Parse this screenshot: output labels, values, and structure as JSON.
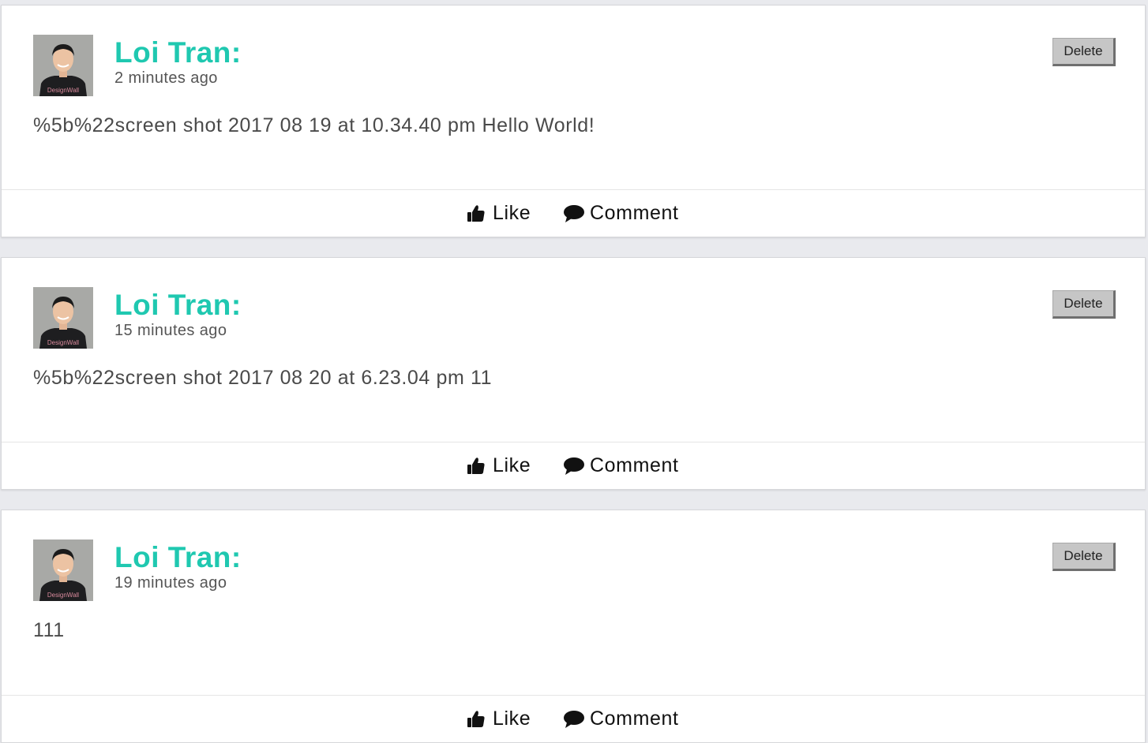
{
  "posts": [
    {
      "author": "Loi Tran:",
      "time_ago": "2 minutes ago",
      "body": "%5b%22screen shot 2017 08 19 at 10.34.40 pm Hello World!",
      "delete_label": "Delete",
      "like_label": "Like",
      "comment_label": "Comment",
      "avatar_shirt_text": "DesignWall"
    },
    {
      "author": "Loi Tran:",
      "time_ago": "15 minutes ago",
      "body": "%5b%22screen shot 2017 08 20 at 6.23.04 pm 11",
      "delete_label": "Delete",
      "like_label": "Like",
      "comment_label": "Comment",
      "avatar_shirt_text": "DesignWall"
    },
    {
      "author": "Loi Tran:",
      "time_ago": "19 minutes ago",
      "body": "111",
      "delete_label": "Delete",
      "like_label": "Like",
      "comment_label": "Comment",
      "avatar_shirt_text": "DesignWall"
    }
  ],
  "icons": {
    "avatar": "profile-photo",
    "like": "thumbs-up-icon",
    "comment": "speech-bubble-icon"
  },
  "colors": {
    "author_name": "#1fc8b0",
    "page_background": "#e9eaee",
    "card_background": "#ffffff",
    "delete_button": "#c6c6c6"
  }
}
